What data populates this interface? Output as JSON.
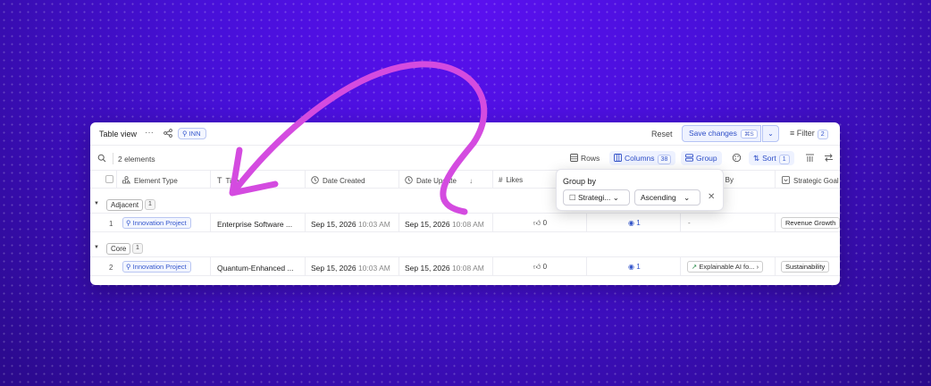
{
  "header": {
    "title": "Table view",
    "more_glyph": "···",
    "badge": "INN",
    "reset_label": "Reset",
    "save_label": "Save changes",
    "save_shortcut": "⌘S",
    "filter_label": "Filter",
    "filter_count": "2"
  },
  "toolbar": {
    "element_count": "2 elements",
    "rows_label": "Rows",
    "columns_label": "Columns",
    "columns_count": "38",
    "group_label": "Group",
    "sort_label": "Sort",
    "sort_count": "1"
  },
  "columns": {
    "element_type": "Element Type",
    "title": "Title",
    "date_created": "Date Created",
    "date_updated": "Date Update",
    "likes": "Likes",
    "created_by": "Created By",
    "strategic_goal": "Strategic Goal"
  },
  "groups": [
    {
      "label": "Adjacent",
      "count": "1",
      "row": {
        "num": "1",
        "type": "Innovation Project",
        "title": "Enterprise Software ...",
        "created_date": "Sep 15, 2026",
        "created_time": "10:03 AM",
        "updated_date": "Sep 15, 2026",
        "updated_time": "10:08 AM",
        "likes": "0",
        "views": "1",
        "link": "-",
        "goal": "Revenue Growth"
      }
    },
    {
      "label": "Core",
      "count": "1",
      "row": {
        "num": "2",
        "type": "Innovation Project",
        "title": "Quantum-Enhanced ...",
        "created_date": "Sep 15, 2026",
        "created_time": "10:03 AM",
        "updated_date": "Sep 15, 2026",
        "updated_time": "10:08 AM",
        "likes": "0",
        "views": "1",
        "link": "Explainable AI fo...",
        "goal": "Sustainability"
      }
    }
  ],
  "group_popover": {
    "title": "Group by",
    "field": "Strategi...",
    "order": "Ascending"
  },
  "colors": {
    "accent": "#2f4fc7",
    "annotation_arrow": "#d44be0",
    "background": "#4710d8"
  }
}
